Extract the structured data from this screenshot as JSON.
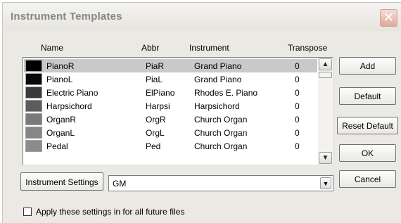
{
  "dialog": {
    "title": "Instrument Templates",
    "close_glyph": "✕"
  },
  "columns": {
    "name": "Name",
    "abbr": "Abbr",
    "instrument": "Instrument",
    "transpose": "Transpose"
  },
  "rows": [
    {
      "color": "#000000",
      "name": "PianoR",
      "abbr": "PiaR",
      "instrument": "Grand Piano",
      "transpose": "0",
      "selected": true
    },
    {
      "color": "#0a0a0a",
      "name": "PianoL",
      "abbr": "PiaL",
      "instrument": "Grand Piano",
      "transpose": "0",
      "selected": false
    },
    {
      "color": "#3a3a3a",
      "name": "Electric Piano",
      "abbr": "ElPiano",
      "instrument": "Rhodes E. Piano",
      "transpose": "0",
      "selected": false
    },
    {
      "color": "#5c5c5c",
      "name": "Harpsichord",
      "abbr": "Harpsi",
      "instrument": "Harpsichord",
      "transpose": "0",
      "selected": false
    },
    {
      "color": "#7a7a7a",
      "name": "OrganR",
      "abbr": "OrgR",
      "instrument": "Church Organ",
      "transpose": "0",
      "selected": false
    },
    {
      "color": "#868686",
      "name": "OrganL",
      "abbr": "OrgL",
      "instrument": "Church Organ",
      "transpose": "0",
      "selected": false
    },
    {
      "color": "#8c8c8c",
      "name": "Pedal",
      "abbr": "Ped",
      "instrument": "Church Organ",
      "transpose": "0",
      "selected": false
    }
  ],
  "buttons": {
    "add": "Add",
    "default": "Default",
    "reset_default": "Reset Default",
    "ok": "OK",
    "cancel": "Cancel",
    "instrument_settings": "Instrument Settings"
  },
  "settings_select": {
    "value": "GM"
  },
  "apply_future": {
    "label": "Apply these settings in for all future files",
    "checked": false
  },
  "icons": {
    "close": "close-icon",
    "scroll_up": "chevron-up-icon",
    "scroll_down": "chevron-down-icon",
    "dropdown": "chevron-down-icon"
  }
}
